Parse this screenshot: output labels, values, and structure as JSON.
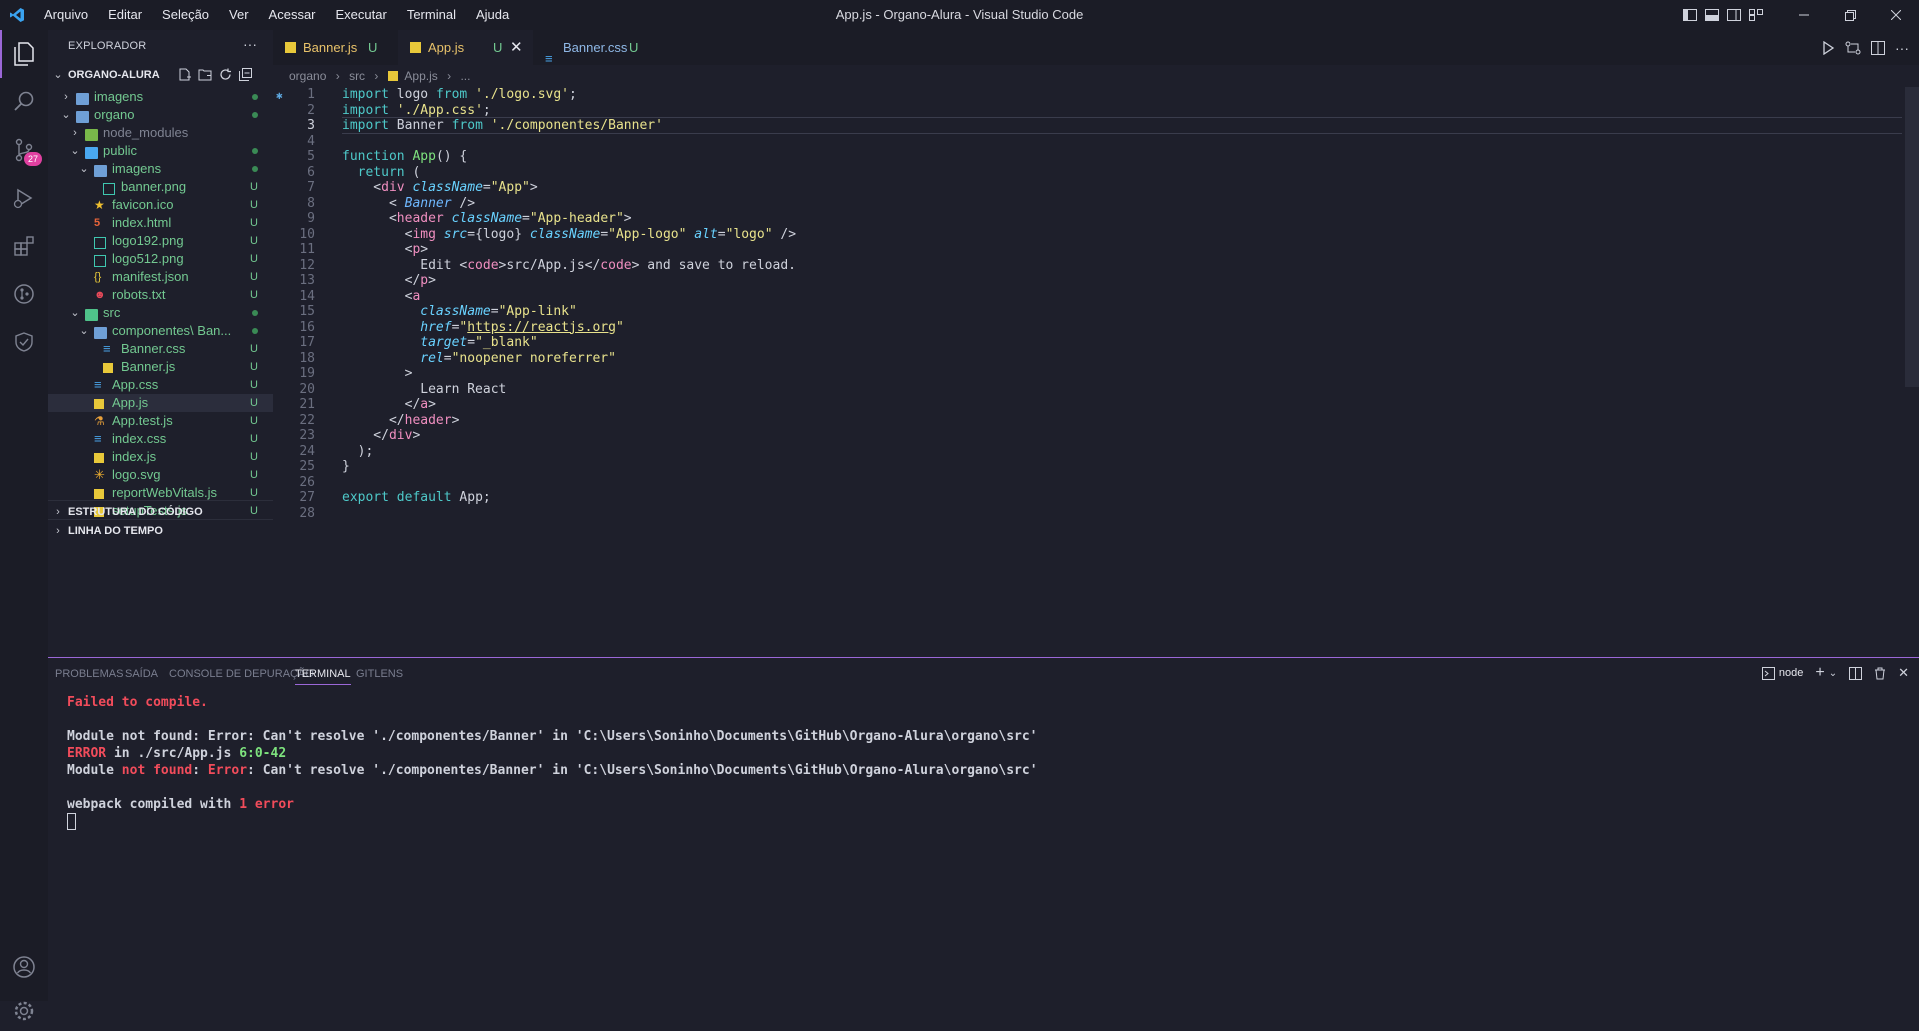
{
  "window_title": "App.js - Organo-Alura - Visual Studio Code",
  "menu": [
    "Arquivo",
    "Editar",
    "Seleção",
    "Ver",
    "Acessar",
    "Executar",
    "Terminal",
    "Ajuda"
  ],
  "explorer": {
    "title": "EXPLORADOR",
    "more": "···",
    "project": "ORGANO-ALURA",
    "rows": [
      {
        "label": "imagens",
        "indent": 1,
        "chevron": "›",
        "icon": "folder",
        "status": "dot"
      },
      {
        "label": "organo",
        "indent": 1,
        "chevron": "⌄",
        "icon": "folder",
        "status": "dot"
      },
      {
        "label": "node_modules",
        "indent": 2,
        "chevron": "›",
        "icon": "folder-node",
        "status": "",
        "muted": true
      },
      {
        "label": "public",
        "indent": 2,
        "chevron": "⌄",
        "icon": "folder-blue",
        "status": "dot"
      },
      {
        "label": "imagens",
        "indent": 3,
        "chevron": "⌄",
        "icon": "folder",
        "status": "dot"
      },
      {
        "label": "banner.png",
        "indent": 4,
        "chevron": "",
        "icon": "image",
        "status": "U"
      },
      {
        "label": "favicon.ico",
        "indent": 3,
        "chevron": "",
        "icon": "star",
        "status": "U"
      },
      {
        "label": "index.html",
        "indent": 3,
        "chevron": "",
        "icon": "html",
        "status": "U"
      },
      {
        "label": "logo192.png",
        "indent": 3,
        "chevron": "",
        "icon": "image",
        "status": "U"
      },
      {
        "label": "logo512.png",
        "indent": 3,
        "chevron": "",
        "icon": "image",
        "status": "U"
      },
      {
        "label": "manifest.json",
        "indent": 3,
        "chevron": "",
        "icon": "json",
        "status": "U"
      },
      {
        "label": "robots.txt",
        "indent": 3,
        "chevron": "",
        "icon": "robot",
        "status": "U"
      },
      {
        "label": "src",
        "indent": 2,
        "chevron": "⌄",
        "icon": "folder-green",
        "status": "dot"
      },
      {
        "label": "componentes\\ Ban...",
        "indent": 3,
        "chevron": "⌄",
        "icon": "folder",
        "status": "dot"
      },
      {
        "label": "Banner.css",
        "indent": 4,
        "chevron": "",
        "icon": "css",
        "status": "U"
      },
      {
        "label": "Banner.js",
        "indent": 4,
        "chevron": "",
        "icon": "js",
        "status": "U"
      },
      {
        "label": "App.css",
        "indent": 3,
        "chevron": "",
        "icon": "css",
        "status": "U"
      },
      {
        "label": "App.js",
        "indent": 3,
        "chevron": "",
        "icon": "js",
        "status": "U",
        "selected": true
      },
      {
        "label": "App.test.js",
        "indent": 3,
        "chevron": "",
        "icon": "test",
        "status": "U"
      },
      {
        "label": "index.css",
        "indent": 3,
        "chevron": "",
        "icon": "css",
        "status": "U"
      },
      {
        "label": "index.js",
        "indent": 3,
        "chevron": "",
        "icon": "js",
        "status": "U"
      },
      {
        "label": "logo.svg",
        "indent": 3,
        "chevron": "",
        "icon": "svg",
        "status": "U"
      },
      {
        "label": "reportWebVitals.js",
        "indent": 3,
        "chevron": "",
        "icon": "js",
        "status": "U"
      },
      {
        "label": "setupTests.js",
        "indent": 3,
        "chevron": "",
        "icon": "js",
        "status": "U"
      }
    ],
    "outline": "ESTRUTURA DO CÓDIGO",
    "timeline": "LINHA DO TEMPO",
    "scm_badge": "27"
  },
  "tabs": [
    {
      "label": "Banner.js",
      "status": "U",
      "icon": "js",
      "active": false
    },
    {
      "label": "App.js",
      "status": "U",
      "icon": "js",
      "active": true
    },
    {
      "label": "Banner.css",
      "status": "U",
      "icon": "css",
      "active": false
    }
  ],
  "breadcrumb": {
    "parts": [
      "organo",
      "src",
      "App.js",
      "..."
    ],
    "sep": "›"
  },
  "code_lines": [
    "import logo from './logo.svg';",
    "import './App.css';",
    "import Banner from './componentes/Banner'",
    "",
    "function App() {",
    "  return (",
    "    <div className=\"App\">",
    "      < Banner />",
    "      <header className=\"App-header\">",
    "        <img src={logo} className=\"App-logo\" alt=\"logo\" />",
    "        <p>",
    "          Edit <code>src/App.js</code> and save to reload.",
    "        </p>",
    "        <a",
    "          className=\"App-link\"",
    "          href=\"https://reactjs.org\"",
    "          target=\"_blank\"",
    "          rel=\"noopener noreferrer\"",
    "        >",
    "          Learn React",
    "        </a>",
    "      </header>",
    "    </div>",
    "  );",
    "}",
    "",
    "export default App;",
    ""
  ],
  "current_line": 3,
  "panel": {
    "tabs": [
      "PROBLEMAS",
      "SAÍDA",
      "CONSOLE DE DEPURAÇÃO",
      "TERMINAL",
      "GITLENS"
    ],
    "active_tab": "TERMINAL",
    "terminal_name": "node",
    "terminal": {
      "l1": "Failed to compile.",
      "l2": "Module not found: Error: Can't resolve './componentes/Banner' in 'C:\\Users\\Soninho\\Documents\\GitHub\\Organo-Alura\\organo\\src'",
      "l3a": "ERROR",
      "l3b": " in ./src/App.js ",
      "l3c": "6:0-42",
      "l4a": "Module ",
      "l4b": "not found",
      "l4c": ": ",
      "l4d": "Error",
      "l4e": ": Can't resolve './componentes/Banner' in 'C:\\Users\\Soninho\\Documents\\GitHub\\Organo-Alura\\organo\\src'",
      "l5a": "webpack compiled with ",
      "l5b": "1 error"
    }
  }
}
